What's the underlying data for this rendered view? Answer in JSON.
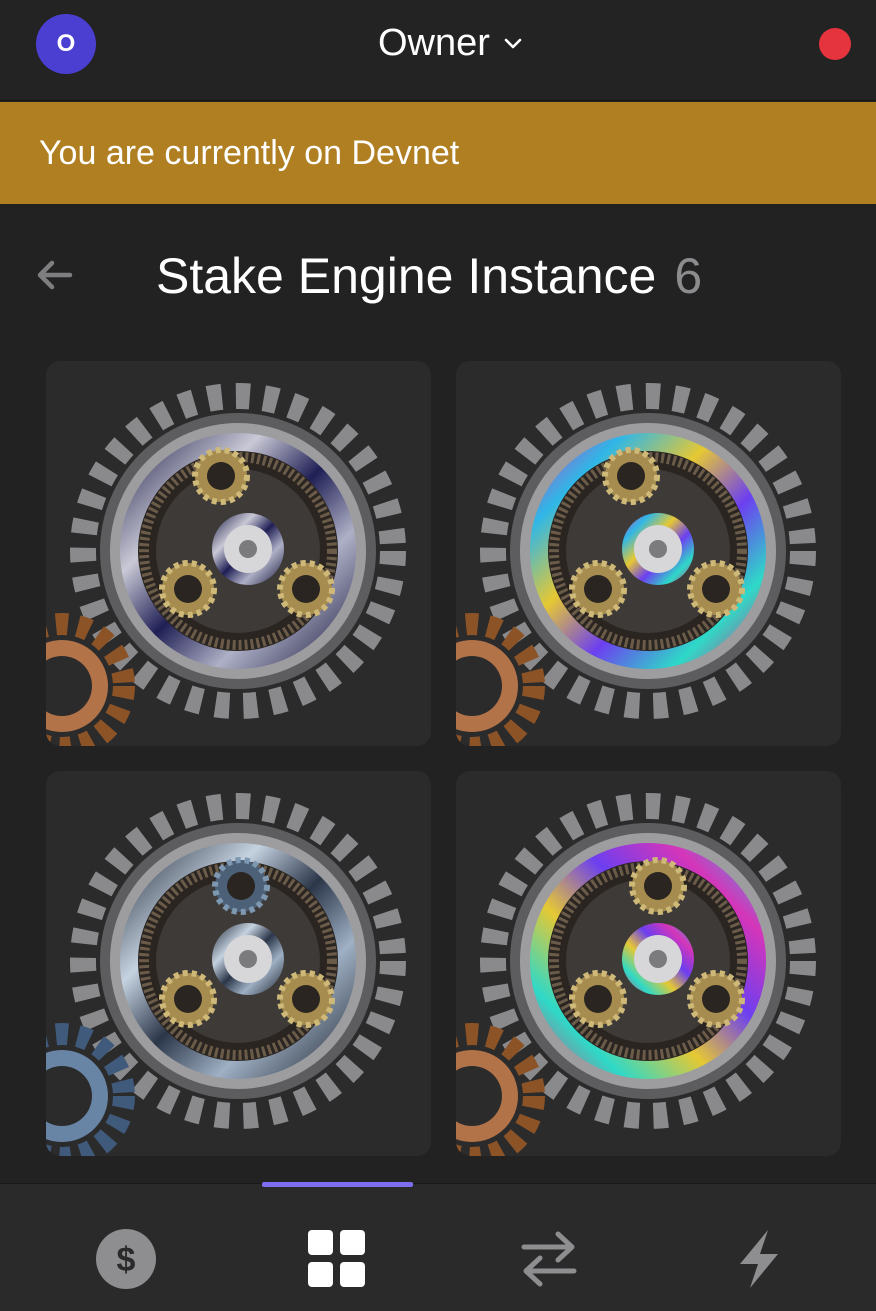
{
  "header": {
    "avatar_initial": "O",
    "account_name": "Owner",
    "status_color": "#e5343e"
  },
  "banner": {
    "text": "You are currently on Devnet"
  },
  "page": {
    "title": "Stake Engine Instance",
    "count": "6"
  },
  "nfts": [
    {
      "name": "stake-engine-nft-1",
      "ring_style": "dark-blue-swirl",
      "small_gear": "bronze"
    },
    {
      "name": "stake-engine-nft-2",
      "ring_style": "rainbow-swirl",
      "small_gear": "bronze"
    },
    {
      "name": "stake-engine-nft-3",
      "ring_style": "silver-blue-swirl",
      "small_gear": "blue-steel"
    },
    {
      "name": "stake-engine-nft-4",
      "ring_style": "rainbow-swirl",
      "small_gear": "bronze"
    }
  ],
  "tabs": [
    {
      "name": "tab-tokens",
      "icon": "dollar-icon",
      "active": false
    },
    {
      "name": "tab-collectibles",
      "icon": "grid-icon",
      "active": true
    },
    {
      "name": "tab-swap",
      "icon": "swap-icon",
      "active": false
    },
    {
      "name": "tab-activity",
      "icon": "lightning-icon",
      "active": false
    }
  ],
  "colors": {
    "accent": "#7d6ef0",
    "banner": "#b07f22",
    "avatar": "#4b3fd1"
  }
}
